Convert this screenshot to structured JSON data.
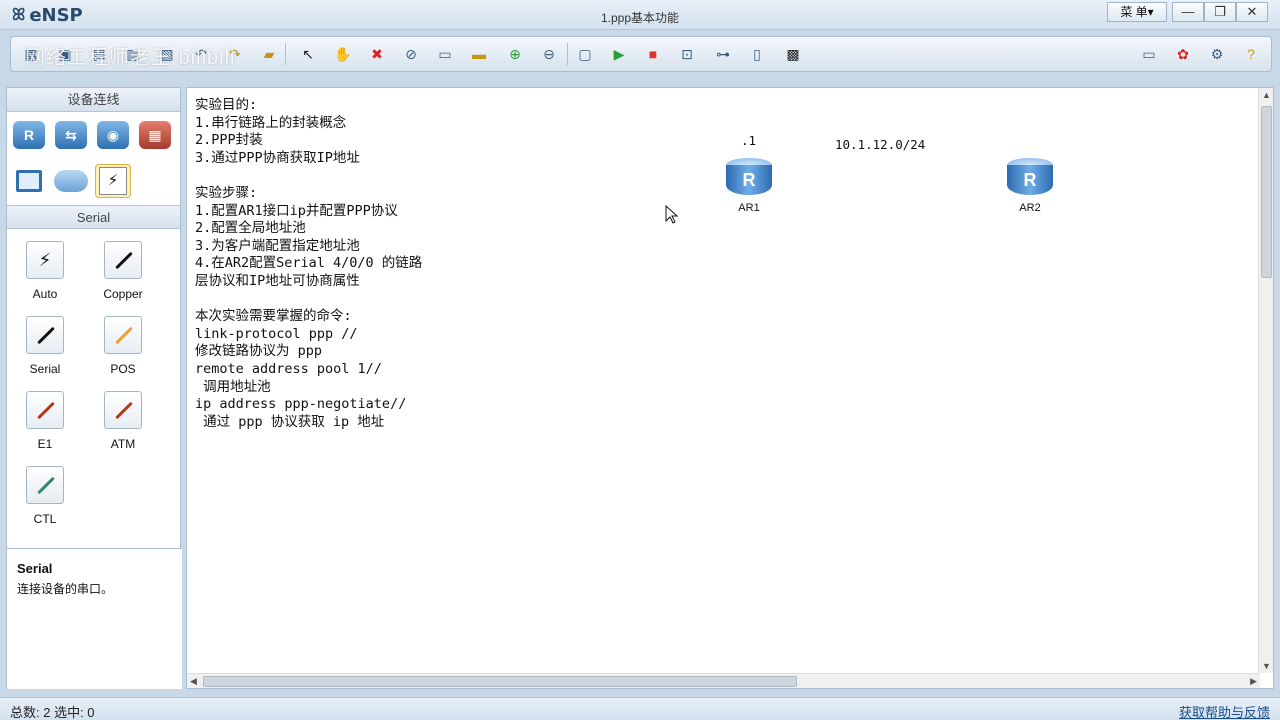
{
  "app": {
    "name": "eNSP",
    "window_title": "1.ppp基本功能",
    "menu_label": "菜 单▾"
  },
  "window_controls": {
    "minimize": "—",
    "restore": "❐",
    "close": "✕"
  },
  "watermark": "网络工程师老王 bilibili",
  "toolbar": {
    "icons": [
      "new-topo-icon",
      "open-icon",
      "save-icon",
      "save-as-icon",
      "print-icon",
      "undo-icon",
      "redo-icon",
      "select-icon",
      "hand-icon",
      "delete-icon",
      "delete-link-icon",
      "text-icon",
      "rectangle-icon",
      "zoom-in-icon",
      "zoom-out-icon",
      "fit-icon",
      "start-icon",
      "stop-icon",
      "capture-icon",
      "topology-icon",
      "palette-icon",
      "terminal-icon"
    ],
    "right_icons": [
      "chat-icon",
      "huawei-icon",
      "settings-icon",
      "help-icon"
    ]
  },
  "left_panel": {
    "header": "设备连线",
    "devices": [
      "router-icon",
      "switch-icon",
      "wlan-icon",
      "firewall-icon",
      "pc-icon",
      "cloud-icon",
      "cable-icon"
    ],
    "section": "Serial",
    "cables": [
      {
        "label": "Auto",
        "color": "#111111"
      },
      {
        "label": "Copper",
        "color": "#111111"
      },
      {
        "label": "Serial",
        "color": "#111111"
      },
      {
        "label": "POS",
        "color": "#f0a030"
      },
      {
        "label": "E1",
        "color": "#b33a1a"
      },
      {
        "label": "ATM",
        "color": "#b33a1a"
      },
      {
        "label": "CTL",
        "color": "#2b8a6a"
      }
    ],
    "info": {
      "title": "Serial",
      "desc": "连接设备的串口。"
    }
  },
  "canvas": {
    "notes": "实验目的:\n1.串行链路上的封装概念\n2.PPP封装\n3.通过PPP协商获取IP地址\n\n实验步骤:\n1.配置AR1接口ip并配置PPP协议\n2.配置全局地址池\n3.为客户端配置指定地址池\n4.在AR2配置Serial 4/0/0 的链路\n层协议和IP地址可协商属性\n\n本次实验需要掌握的命令:\nlink-protocol ppp //\n修改链路协议为 ppp\nremote address pool 1//\n 调用地址池\nip address ppp-negotiate//\n 通过 ppp 协议获取 ip 地址",
    "label_dot1": ".1",
    "label_subnet": "10.1.12.0/24",
    "nodes": [
      {
        "name": "AR1"
      },
      {
        "name": "AR2"
      }
    ]
  },
  "status": {
    "left": "总数: 2 选中: 0",
    "right": "获取帮助与反馈"
  }
}
